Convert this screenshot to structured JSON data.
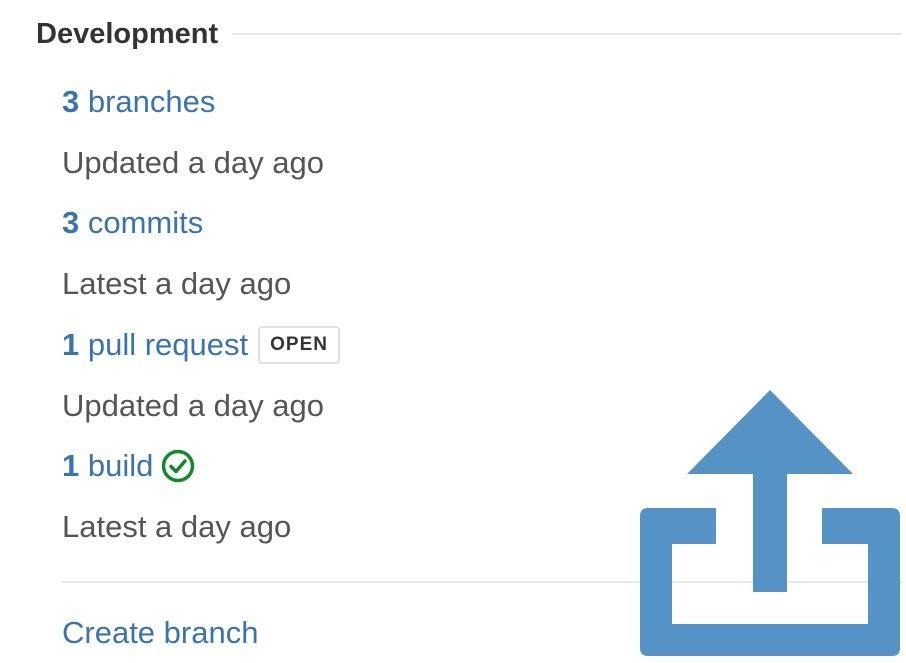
{
  "development": {
    "title": "Development",
    "branches": {
      "count": "3",
      "label": " branches",
      "meta": "Updated a day ago"
    },
    "commits": {
      "count": "3",
      "label": " commits",
      "meta": "Latest a day ago"
    },
    "pull_requests": {
      "count": "1",
      "label": " pull request",
      "status": "OPEN",
      "meta": "Updated a day ago"
    },
    "builds": {
      "count": "1",
      "label": " build",
      "status_icon": "success-check-icon",
      "meta": "Latest a day ago"
    },
    "create_branch_label": "Create branch"
  },
  "overlay_icon": "export-share-icon",
  "colors": {
    "link": "#3b73af",
    "success": "#14892c",
    "export_icon": "#5593c6"
  }
}
